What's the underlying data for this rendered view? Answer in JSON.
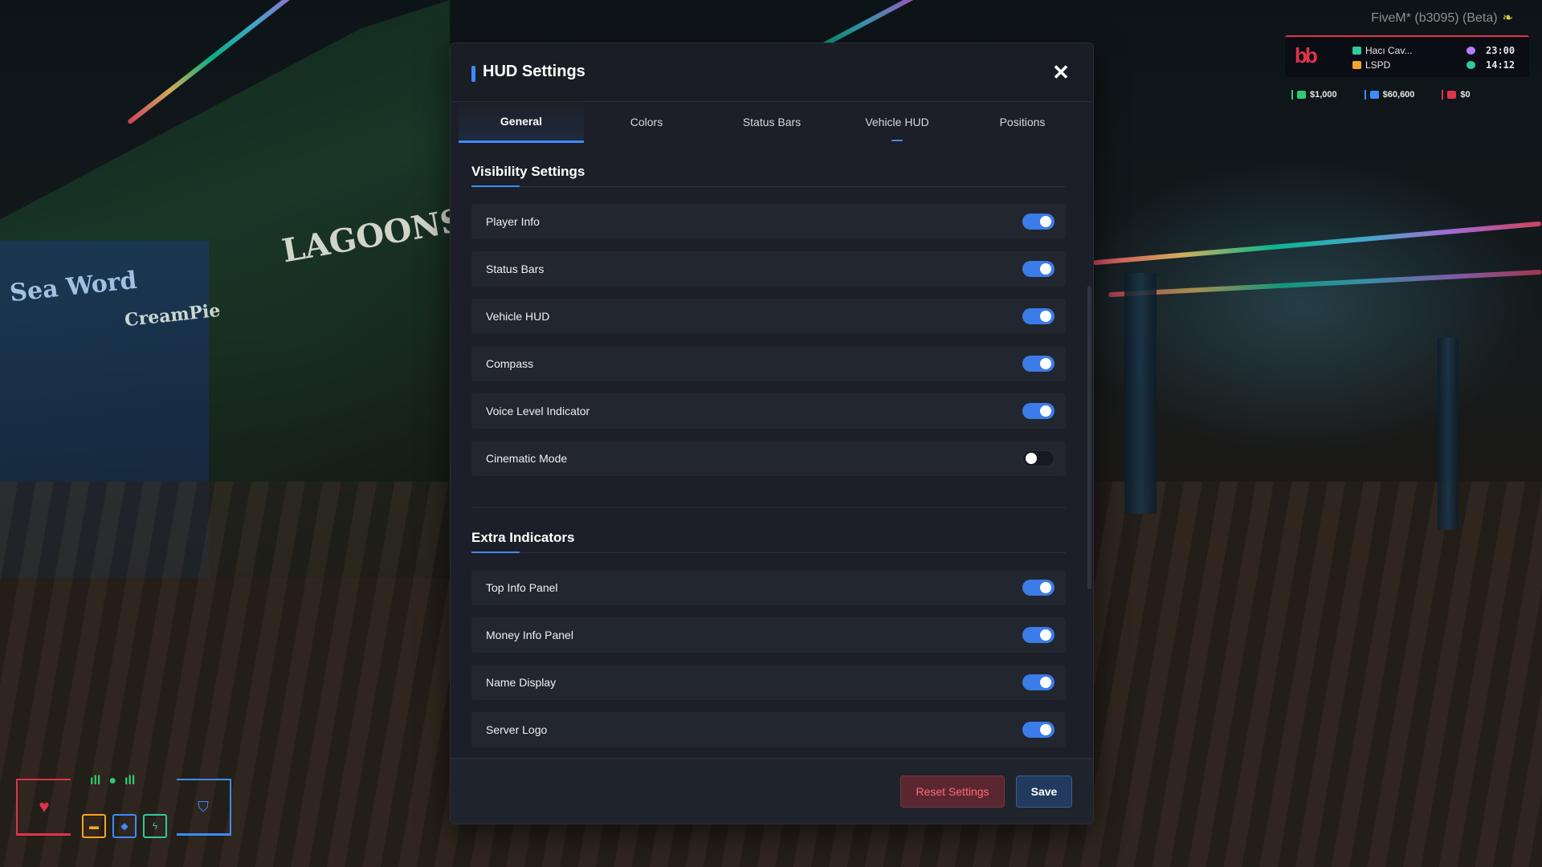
{
  "window": {
    "title": "FiveM* (b3095) (Beta)"
  },
  "hud_top": {
    "player_name": "Hacı Cav...",
    "job": "LSPD",
    "time_primary": "23:00",
    "time_secondary": "14:12",
    "money": [
      {
        "label": "$1,000",
        "icon": "cash-icon",
        "color": "#2ecc71"
      },
      {
        "label": "$60,600",
        "icon": "bank-icon",
        "color": "#3b8cff"
      },
      {
        "label": "$0",
        "icon": "dirty-money-icon",
        "color": "#e0344a"
      }
    ]
  },
  "modal": {
    "title": "HUD Settings",
    "tabs": [
      {
        "label": "General",
        "active": true
      },
      {
        "label": "Colors",
        "active": false
      },
      {
        "label": "Status Bars",
        "active": false
      },
      {
        "label": "Vehicle HUD",
        "active": false
      },
      {
        "label": "Positions",
        "active": false
      }
    ],
    "sections": [
      {
        "title": "Visibility Settings",
        "items": [
          {
            "label": "Player Info",
            "enabled": true
          },
          {
            "label": "Status Bars",
            "enabled": true
          },
          {
            "label": "Vehicle HUD",
            "enabled": true
          },
          {
            "label": "Compass",
            "enabled": true
          },
          {
            "label": "Voice Level Indicator",
            "enabled": true
          },
          {
            "label": "Cinematic Mode",
            "enabled": false
          }
        ]
      },
      {
        "title": "Extra Indicators",
        "items": [
          {
            "label": "Top Info Panel",
            "enabled": true
          },
          {
            "label": "Money Info Panel",
            "enabled": true
          },
          {
            "label": "Name Display",
            "enabled": true
          },
          {
            "label": "Server Logo",
            "enabled": true
          }
        ]
      }
    ],
    "footer": {
      "reset_label": "Reset Settings",
      "save_label": "Save"
    }
  },
  "colors": {
    "accent": "#3b8cff",
    "danger": "#e0344a",
    "panel_bg": "#1c1f27"
  }
}
